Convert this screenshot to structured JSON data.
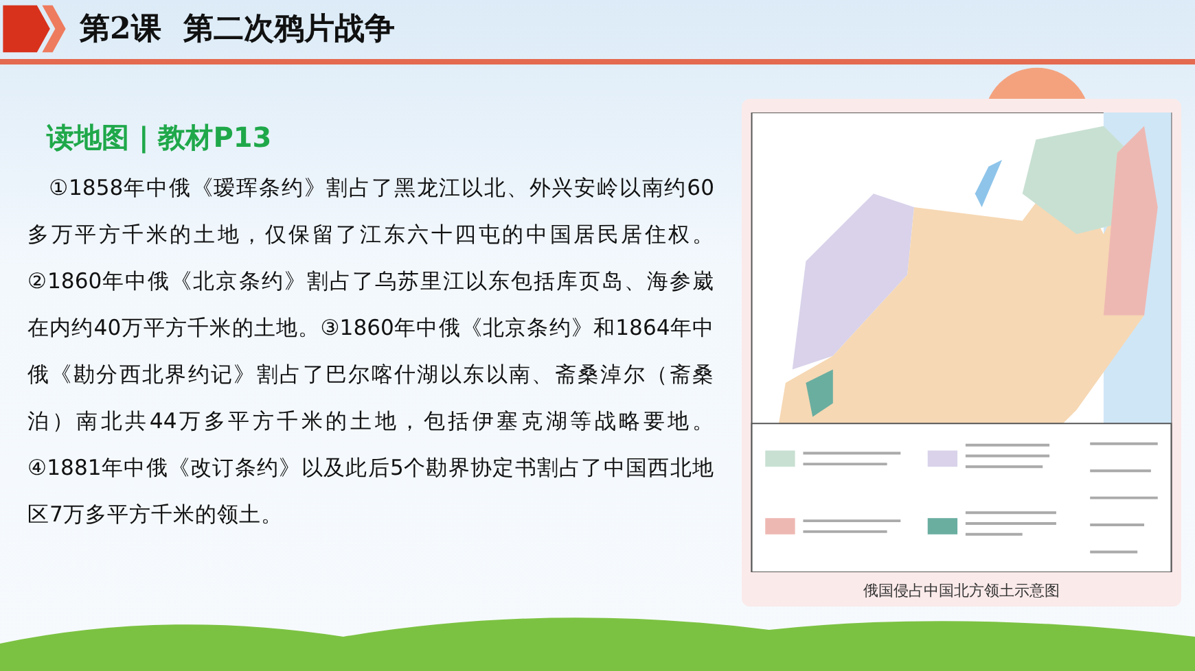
{
  "header": {
    "lesson": "第2课",
    "title": "第二次鸦片战争"
  },
  "section": {
    "heading": "读地图 | 教材P13",
    "paragraph": "①1858年中俄《瑷珲条约》割占了黑龙江以北、外兴安岭以南约60多万平方千米的土地，仅保留了江东六十四屯的中国居民居住权。②1860年中俄《北京条约》割占了乌苏里江以东包括库页岛、海参崴在内约40万平方千米的土地。③1860年中俄《北京条约》和1864年中俄《勘分西北界约记》割占了巴尔喀什湖以东以南、斋桑淖尔（斋桑泊）南北共44万多平方千米的土地，包括伊塞克湖等战略要地。④1881年中俄《改订条约》以及此后5个勘界协定书割占了中国西北地区7万多平方千米的领土。"
  },
  "map": {
    "caption": "俄国侵占中国北方领土示意图"
  }
}
